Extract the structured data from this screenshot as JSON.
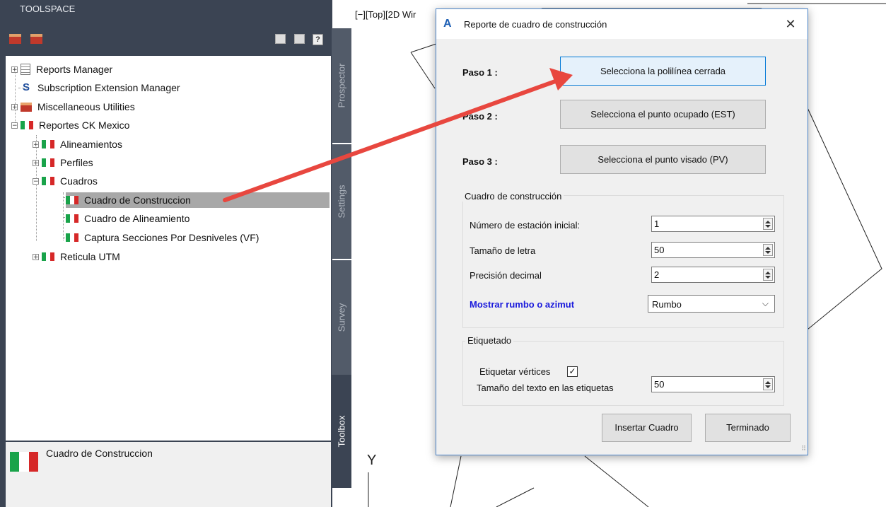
{
  "toolspace": {
    "title": "TOOLSPACE",
    "toolbar_icons": [
      "toolbox-icon",
      "toolbox-edit-icon",
      "tree-view-icon",
      "list-view-icon",
      "help-icon"
    ],
    "tree": [
      {
        "label": "Reports Manager",
        "icon": "report-icon",
        "expander": "+"
      },
      {
        "label": "Subscription Extension Manager",
        "icon": "s-icon"
      },
      {
        "label": "Miscellaneous Utilities",
        "icon": "toolbox-icon",
        "expander": "+"
      },
      {
        "label": "Reportes CK Mexico",
        "icon": "mexico-flag-icon",
        "expander": "−"
      },
      {
        "label": "Alineamientos",
        "icon": "mexico-flag-icon",
        "expander": "+"
      },
      {
        "label": "Perfiles",
        "icon": "mexico-flag-icon",
        "expander": "+"
      },
      {
        "label": "Cuadros",
        "icon": "mexico-flag-icon",
        "expander": "−"
      },
      {
        "label": "Cuadro de Construccion",
        "icon": "mexico-flag-icon",
        "selected": true
      },
      {
        "label": "Cuadro de Alineamiento",
        "icon": "mexico-flag-icon"
      },
      {
        "label": "Captura Secciones Por Desniveles (VF)",
        "icon": "mexico-flag-icon"
      },
      {
        "label": "Reticula UTM",
        "icon": "mexico-flag-icon",
        "expander": "+"
      }
    ],
    "detail_label": "Cuadro de Construccion",
    "tabs": [
      "Prospector",
      "Settings",
      "Survey",
      "Toolbox"
    ]
  },
  "viewport": {
    "label": "[−][Top][2D Wir"
  },
  "dialog": {
    "title": "Reporte de cuadro de construcción",
    "close": "✕",
    "paso1": "Paso 1 :",
    "paso2": "Paso 2 :",
    "paso3": "Paso 3 :",
    "btn1": "Selecciona la polilínea cerrada",
    "btn2": "Selecciona el punto ocupado (EST)",
    "btn3": "Selecciona el punto visado (PV)",
    "group1_title": "Cuadro de construcción",
    "estacion_label": "Número de estación inicial:",
    "estacion_value": "1",
    "letra_label": "Tamaño de letra",
    "letra_value": "50",
    "precision_label": "Precisión decimal",
    "precision_value": "2",
    "rumbo_label": "Mostrar rumbo o azimut",
    "rumbo_value": "Rumbo",
    "group2_title": "Etiquetado",
    "etiquetar_label": "Etiquetar vértices",
    "etiquetar_checked": "✓",
    "texto_label": "Tamaño del texto en las etiquetas",
    "texto_value": "50",
    "insertar": "Insertar Cuadro",
    "terminado": "Terminado"
  },
  "ucs": {
    "y": "Y"
  },
  "colors": {
    "accent": "#1d5fb4",
    "rumbo_label": "#1a1adc",
    "arrow": "#e8473f"
  }
}
